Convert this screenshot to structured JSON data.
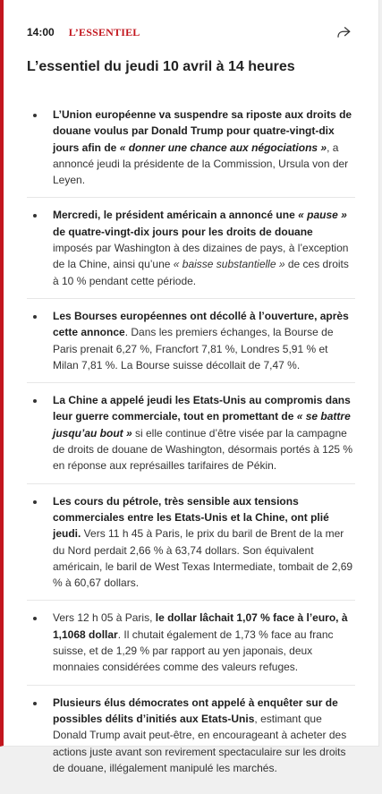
{
  "header": {
    "time": "14:00",
    "tag": "L’ESSENTIEL"
  },
  "icons": {
    "share": "share-arrow-icon"
  },
  "title": "L’essentiel du jeudi 10 avril à 14 heures",
  "items": [
    [
      {
        "t": "L’Union européenne va suspendre sa riposte aux droits de douane voulus par Donald Trump pour quatre-vingt-dix jours afin de ",
        "s": "b"
      },
      {
        "t": "« donner une chance aux négociations »",
        "s": "bi"
      },
      {
        "t": ", a annoncé jeudi la présidente de la Commission, Ursula von der Leyen.",
        "s": ""
      }
    ],
    [
      {
        "t": "Mercredi, le président américain a annoncé une ",
        "s": "b"
      },
      {
        "t": "« pause »",
        "s": "bi"
      },
      {
        "t": " de quatre-vingt-dix jours pour les droits de douane",
        "s": "b"
      },
      {
        "t": " imposés par Washington à des dizaines de pays, à l’exception de la Chine, ainsi qu’une ",
        "s": ""
      },
      {
        "t": "« baisse substantielle »",
        "s": "i"
      },
      {
        "t": " de ces droits à 10 % pendant cette période.",
        "s": ""
      }
    ],
    [
      {
        "t": "Les Bourses européennes ont décollé à l’ouverture, après cette annonce",
        "s": "b"
      },
      {
        "t": ". Dans les premiers échanges, la Bourse de Paris prenait 6,27 %, Francfort 7,81 %, Londres 5,91 % et Milan 7,81 %. La Bourse suisse décollait de 7,47 %.",
        "s": ""
      }
    ],
    [
      {
        "t": "La Chine a appelé jeudi les Etats-Unis au compromis dans leur guerre commerciale, tout en promettant de ",
        "s": "b"
      },
      {
        "t": "« se battre jusqu’au bout »",
        "s": "bi"
      },
      {
        "t": " si elle continue d’être visée par la campagne de droits de douane de Washington, désormais portés à 125 % en réponse aux représailles tarifaires de Pékin.",
        "s": ""
      }
    ],
    [
      {
        "t": "Les cours du pétrole, très sensible aux tensions commerciales entre les Etats-Unis et la Chine, ont plié jeudi.",
        "s": "b"
      },
      {
        "t": " Vers 11 h 45 à Paris, le prix du baril de Brent de la mer du Nord perdait 2,66 % à 63,74 dollars. Son équivalent américain, le baril de West Texas Intermediate, tombait de 2,69 % à 60,67 dollars.",
        "s": ""
      }
    ],
    [
      {
        "t": "Vers 12 h 05 à Paris, ",
        "s": ""
      },
      {
        "t": "le dollar lâchait 1,07 % face à l’euro, à 1,1068 dollar",
        "s": "b"
      },
      {
        "t": ". Il chutait également de 1,73 % face au franc suisse, et de 1,29 % par rapport au yen japonais, deux monnaies considérées comme des valeurs refuges.",
        "s": ""
      }
    ],
    [
      {
        "t": "Plusieurs élus démocrates ont appelé à enquêter sur de possibles délits d’initiés aux Etats-Unis",
        "s": "b"
      },
      {
        "t": ", estimant que Donald Trump avait peut-être, en encourageant à acheter des actions juste avant son revirement spectaculaire sur les droits de douane, illégalement manipulé les marchés.",
        "s": ""
      }
    ]
  ]
}
